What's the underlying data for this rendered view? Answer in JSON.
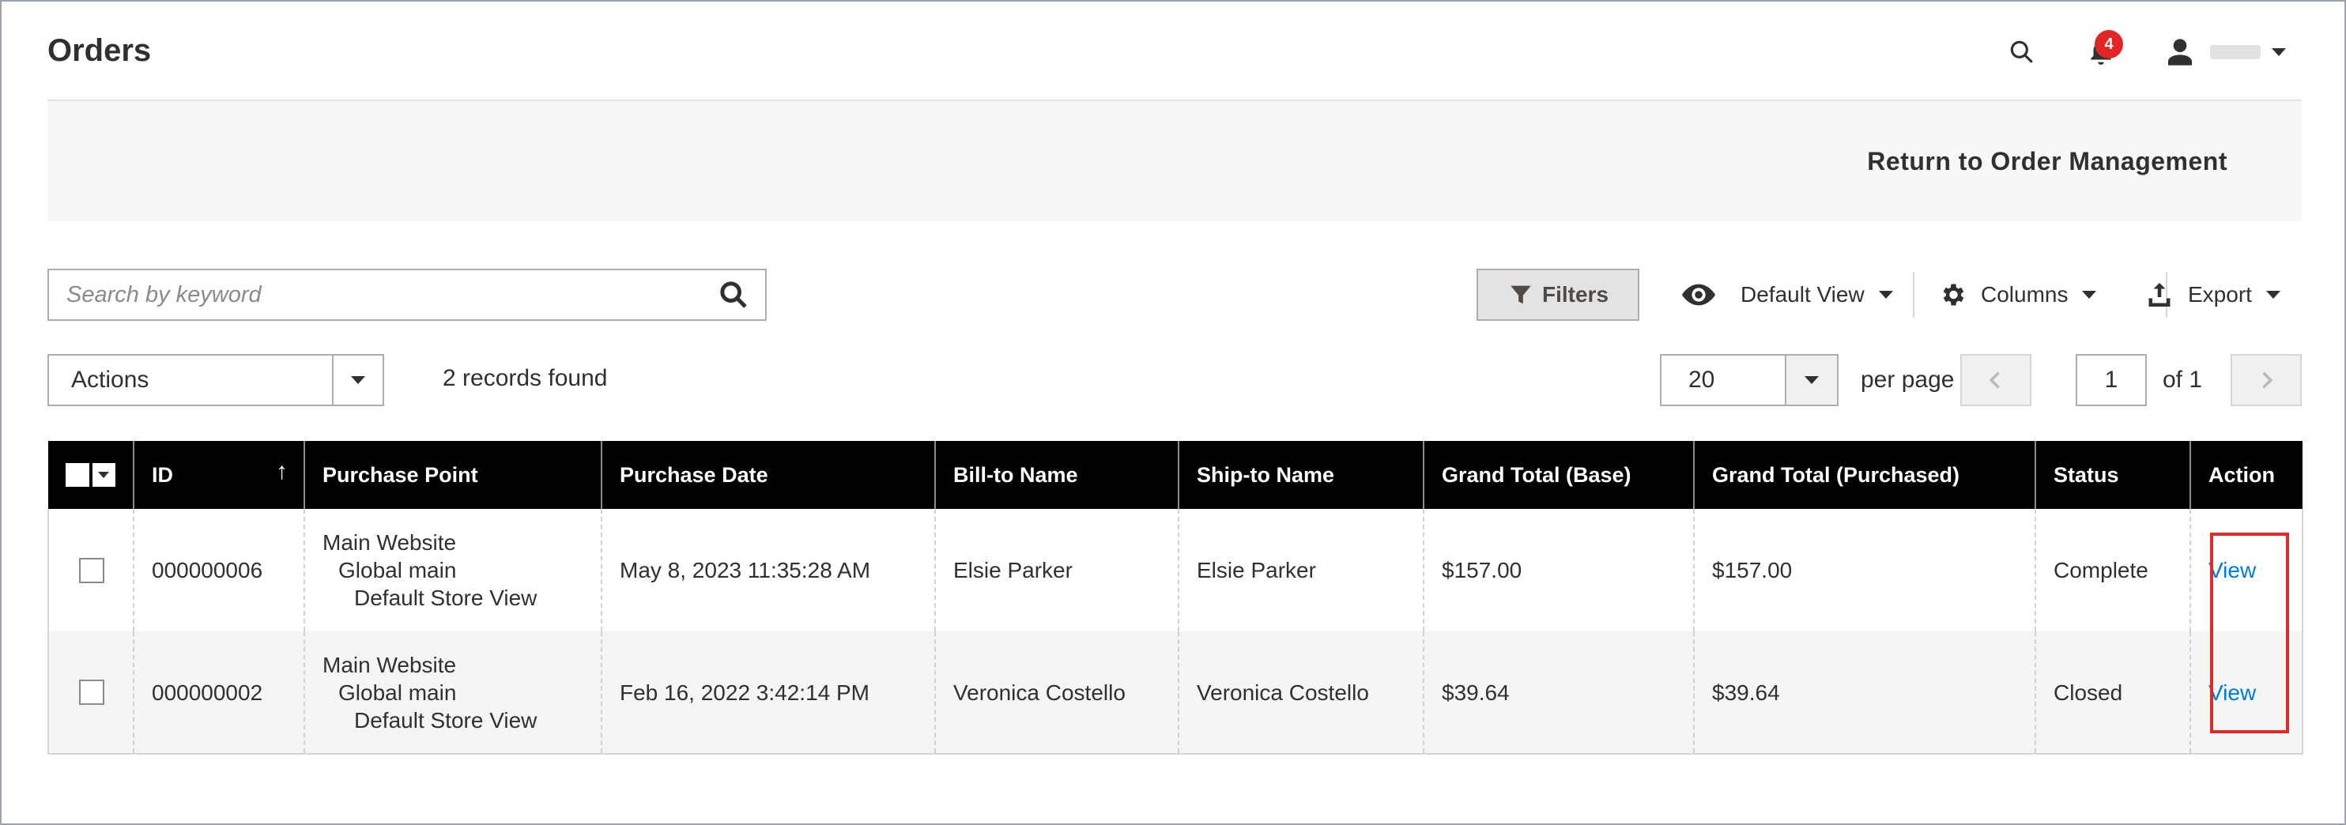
{
  "header": {
    "title": "Orders",
    "notifications_count": "4",
    "icons": {
      "search": "search-icon",
      "notifications": "bell-icon",
      "user": "user-icon"
    }
  },
  "page_actions": {
    "return_label": "Return to Order Management"
  },
  "toolbar": {
    "search_placeholder": "Search by keyword",
    "filters_label": "Filters",
    "view_label": "Default View",
    "columns_label": "Columns",
    "export_label": "Export"
  },
  "mass_actions": {
    "label": "Actions"
  },
  "records_found": "2 records found",
  "pagination": {
    "per_page_value": "20",
    "per_page_label": "per page",
    "current_page": "1",
    "of_label": "of 1"
  },
  "grid": {
    "columns": [
      "ID",
      "Purchase Point",
      "Purchase Date",
      "Bill-to Name",
      "Ship-to Name",
      "Grand Total (Base)",
      "Grand Total (Purchased)",
      "Status",
      "Action"
    ],
    "sort_indicator": "↑",
    "rows": [
      {
        "id": "000000006",
        "purchase_point": [
          "Main Website",
          "Global main",
          "Default Store View"
        ],
        "purchase_date": "May 8, 2023 11:35:28 AM",
        "bill_to": "Elsie Parker",
        "ship_to": "Elsie Parker",
        "grand_total_base": "$157.00",
        "grand_total_purchased": "$157.00",
        "status": "Complete",
        "action": "View"
      },
      {
        "id": "000000002",
        "purchase_point": [
          "Main Website",
          "Global main",
          "Default Store View"
        ],
        "purchase_date": "Feb 16, 2022 3:42:14 PM",
        "bill_to": "Veronica Costello",
        "ship_to": "Veronica Costello",
        "grand_total_base": "$39.64",
        "grand_total_purchased": "$39.64",
        "status": "Closed",
        "action": "View"
      }
    ]
  },
  "colors": {
    "link": "#007bdb",
    "highlight": "#e02b27",
    "badge": "#e22626",
    "header_bg": "#000000"
  }
}
